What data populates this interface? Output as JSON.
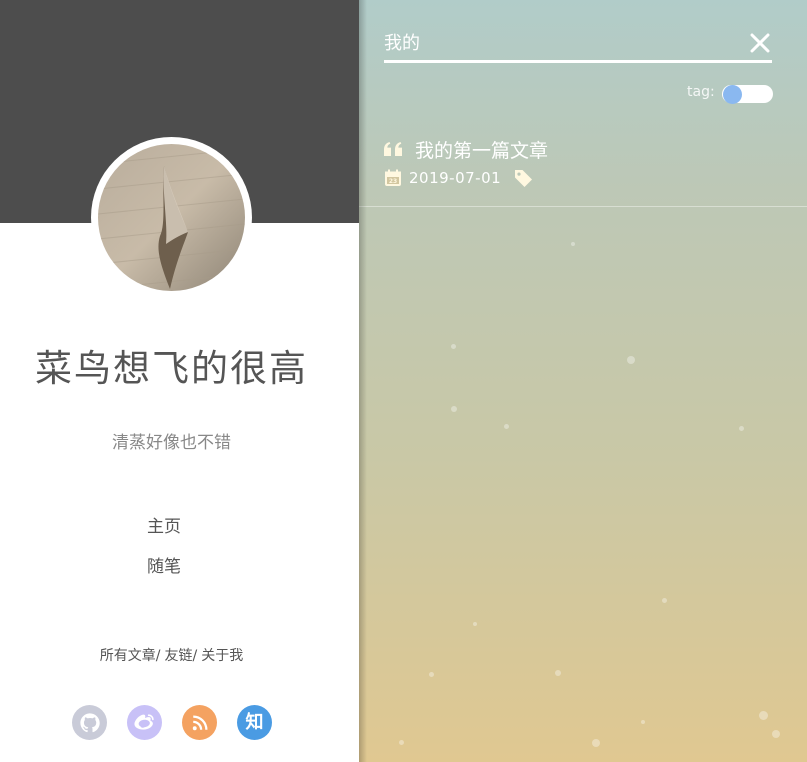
{
  "sidebar": {
    "site_title": "菜鸟想飞的很高",
    "subtitle": "清蒸好像也不错",
    "nav": [
      {
        "label": "主页"
      },
      {
        "label": "随笔"
      }
    ],
    "links": [
      {
        "label": "所有文章",
        "sep": "/"
      },
      {
        "label": "友链",
        "sep": "/"
      },
      {
        "label": "关于我",
        "sep": ""
      }
    ],
    "socials": [
      {
        "icon": "github-icon",
        "color": "#c9cbd8"
      },
      {
        "icon": "weibo-icon",
        "color": "#c8c1f7"
      },
      {
        "icon": "rss-icon",
        "color": "#f4a261"
      },
      {
        "icon": "zhihu-icon",
        "color": "#4a9be3",
        "glyph": "知"
      }
    ],
    "colors": {
      "banner": "#4d4d4d"
    }
  },
  "search": {
    "query": "我的",
    "tag_label": "tag:",
    "tag_toggle_on": false,
    "results": [
      {
        "title": "我的第一篇文章",
        "date": "2019-07-01"
      }
    ],
    "colors": {
      "accent_text": "#fff8e0",
      "toggle_knob": "#8ab8f0"
    }
  }
}
